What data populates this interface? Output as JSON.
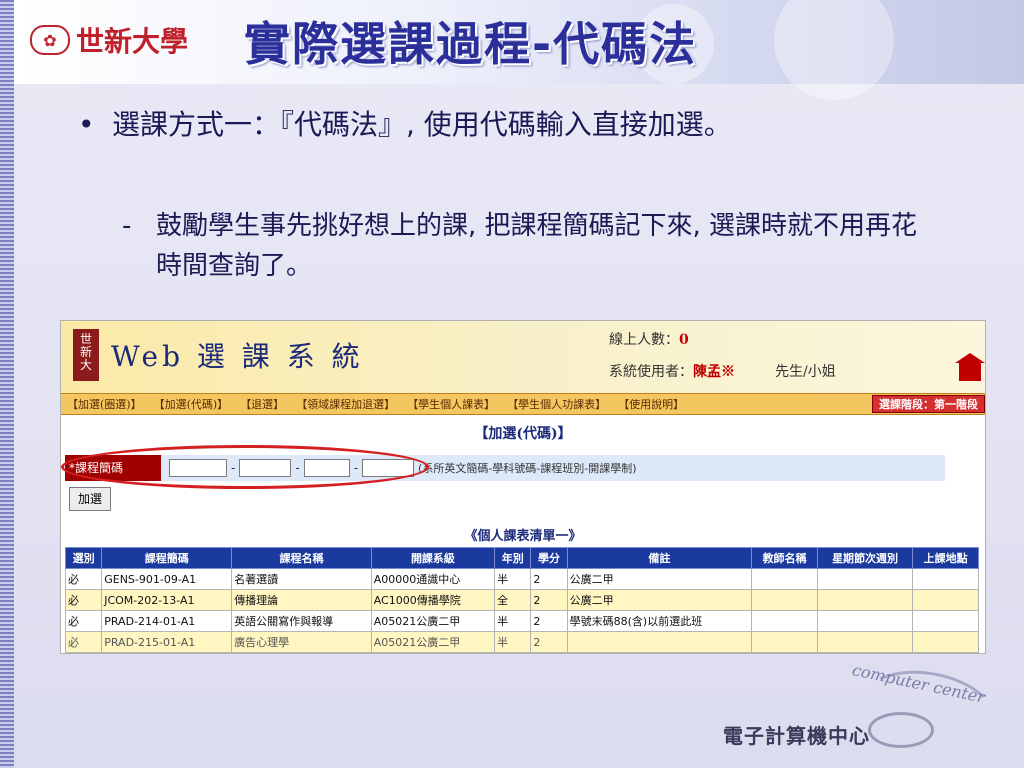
{
  "slide": {
    "logo_text": "世新大學",
    "title": "實際選課過程-代碼法",
    "bullet1": "選課方式一：『代碼法』, 使用代碼輸入直接加選。",
    "bullet2": "鼓勵學生事先挑好想上的課, 把課程簡碼記下來, 選課時就不用再花時間查詢了。",
    "bullet_dot": "•",
    "bullet_dash": "-"
  },
  "web": {
    "system_title": "Web 選 課 系 統",
    "online_label": "線上人數：",
    "online_count": "0",
    "user_label": "系統使用者：",
    "user_name": "陳孟※",
    "salutation": "先生/小姐",
    "menu": [
      "【加選(圈選)】",
      "【加選(代碼)】",
      "【退選】",
      "【領域課程加退選】",
      "【學生個人課表】",
      "【學生個人功課表】",
      "【使用說明】"
    ],
    "stage": "選課階段：第一階段",
    "section_title": "【加選(代碼)】",
    "code_label": "*課程簡碼",
    "code_sep": "-",
    "code_hint": "(系所英文簡碼-學科號碼-課程班別-開課學制)",
    "add_button": "加選",
    "list_title": "《個人課表清單一》",
    "table": {
      "headers": [
        "選別",
        "課程簡碼",
        "課程名稱",
        "開課系級",
        "年別",
        "學分",
        "備註",
        "教師名稱",
        "星期節次週別",
        "上課地點"
      ],
      "rows": [
        [
          "必",
          "GENS-901-09-A1",
          "名著選讀",
          "A00000通識中心",
          "半",
          "2",
          "公廣二甲",
          "",
          "",
          ""
        ],
        [
          "必",
          "JCOM-202-13-A1",
          "傳播理論",
          "AC1000傳播學院",
          "全",
          "2",
          "公廣二甲",
          "",
          "",
          ""
        ],
        [
          "必",
          "PRAD-214-01-A1",
          "英語公關寫作與報導",
          "A05021公廣二甲",
          "半",
          "2",
          "學號末碼88(含)以前選此班",
          "",
          "",
          ""
        ],
        [
          "必",
          "PRAD-215-01-A1",
          "廣告心理學",
          "A05021公廣二甲",
          "半",
          "2",
          "",
          "",
          "",
          ""
        ]
      ]
    }
  },
  "footer": {
    "arc_text": "computer center",
    "center_name": "電子計算機中心"
  }
}
